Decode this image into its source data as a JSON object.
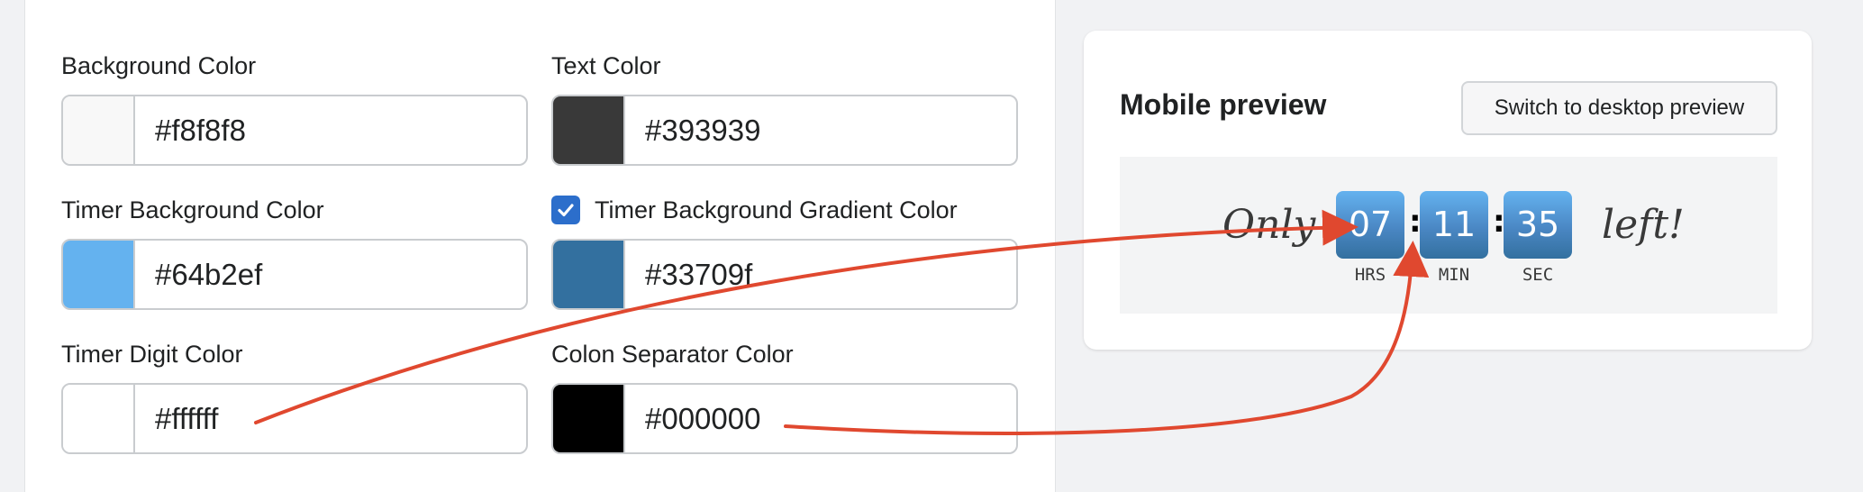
{
  "settings": {
    "background_color": {
      "label": "Background Color",
      "value": "#f8f8f8",
      "swatch": "#f8f8f8"
    },
    "text_color": {
      "label": "Text Color",
      "value": "#393939",
      "swatch": "#393939"
    },
    "timer_bg_color": {
      "label": "Timer Background Color",
      "value": "#64b2ef",
      "swatch": "#64b2ef"
    },
    "timer_gradient_color": {
      "label": "Timer Background Gradient Color",
      "value": "#33709f",
      "swatch": "#33709f",
      "checked": true
    },
    "timer_digit_color": {
      "label": "Timer Digit Color",
      "value": "#ffffff",
      "swatch": "#ffffff"
    },
    "colon_color": {
      "label": "Colon Separator Color",
      "value": "#000000",
      "swatch": "#000000"
    }
  },
  "preview": {
    "title": "Mobile preview",
    "switch_label": "Switch to desktop preview",
    "prefix": "Only",
    "suffix": "left!",
    "hours": "07",
    "minutes": "11",
    "seconds": "35",
    "unit_hours": "HRS",
    "unit_minutes": "MIN",
    "unit_seconds": "SEC",
    "colon": ":"
  },
  "colors": {
    "accent": "#2c6ecb",
    "annotation_arrow": "#e0482f"
  },
  "icons": {
    "checkbox": "checkmark-icon"
  }
}
